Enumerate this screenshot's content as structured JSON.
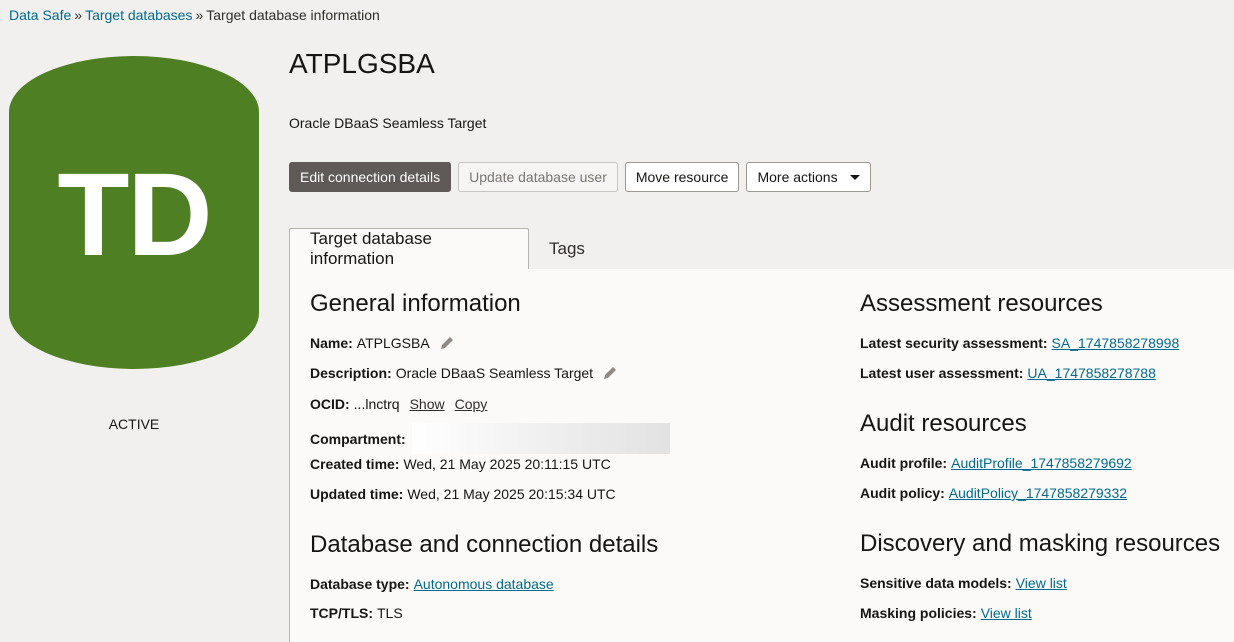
{
  "breadcrumb": {
    "items": [
      "Data Safe",
      "Target databases"
    ],
    "current": "Target database information",
    "separator": "»"
  },
  "badge": {
    "initials": "TD",
    "state": "ACTIVE",
    "color": "#4e7f23"
  },
  "header": {
    "title": "ATPLGSBA",
    "subtitle": "Oracle DBaaS Seamless Target"
  },
  "actions": {
    "edit_connection": "Edit connection details",
    "update_user": "Update database user",
    "move_resource": "Move resource",
    "more_actions": "More actions"
  },
  "tabs": [
    "Target database information",
    "Tags"
  ],
  "general": {
    "heading": "General information",
    "name_label": "Name:",
    "name_value": "ATPLGSBA",
    "description_label": "Description:",
    "description_value": "Oracle DBaaS Seamless Target",
    "ocid_label": "OCID:",
    "ocid_value": "...lnctrq",
    "show_link": "Show",
    "copy_link": "Copy",
    "compartment_label": "Compartment:",
    "created_label": "Created time:",
    "created_value": "Wed, 21 May 2025 20:11:15 UTC",
    "updated_label": "Updated time:",
    "updated_value": "Wed, 21 May 2025 20:15:34 UTC"
  },
  "db": {
    "heading": "Database and connection details",
    "type_label": "Database type:",
    "type_value": "Autonomous database",
    "tcp_label": "TCP/TLS:",
    "tcp_value": "TLS"
  },
  "assessment": {
    "heading": "Assessment resources",
    "security_label": "Latest security assessment:",
    "security_value": "SA_1747858278998",
    "user_label": "Latest user assessment:",
    "user_value": "UA_1747858278788"
  },
  "audit": {
    "heading": "Audit resources",
    "profile_label": "Audit profile:",
    "profile_value": "AuditProfile_1747858279692",
    "policy_label": "Audit policy:",
    "policy_value": "AuditPolicy_1747858279332"
  },
  "discovery": {
    "heading": "Discovery and masking resources",
    "models_label": "Sensitive data models:",
    "models_value": "View list",
    "masking_label": "Masking policies:",
    "masking_value": "View list"
  },
  "icons": {
    "edit": "pencil-icon",
    "dropdown": "caret-down-icon"
  }
}
